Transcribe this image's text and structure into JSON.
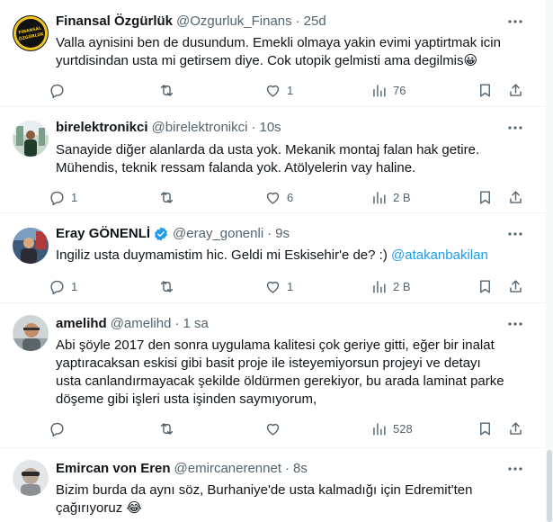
{
  "tweets": [
    {
      "name": "Finansal Özgürlük",
      "handle": "@Ozgurluk_Finans",
      "time": "25d",
      "verified": false,
      "avatar_text": "FİNANSAL ÖZGÜRLÜK",
      "lines": [
        "Valla aynisini ben de dusundum. Emekli olmaya yakin evimi yaptirtmak icin",
        "yurtdisindan usta mi getirsem diye. Cok utopik gelmisti ama degilmis😀"
      ],
      "replies": "",
      "retweets": "",
      "likes": "1",
      "views": "76"
    },
    {
      "name": "birelektronikci",
      "handle": "@birelektronikci",
      "time": "10s",
      "verified": false,
      "lines": [
        "Sanayide diğer alanlarda da usta yok. Mekanik montaj falan hak getire.",
        "Mühendis, teknik ressam falanda yok. Atölyelerin vay haline."
      ],
      "replies": "1",
      "retweets": "",
      "likes": "6",
      "views": "2 B"
    },
    {
      "name": "Eray GÖNENLİ",
      "handle": "@eray_gonenli",
      "time": "9s",
      "verified": true,
      "lines": [
        "Ingiliz usta duymamistim hic. Geldi mi Eskisehir'e de? :) "
      ],
      "mention": "@atakanbakilan",
      "replies": "1",
      "retweets": "",
      "likes": "1",
      "views": "2 B"
    },
    {
      "name": "amelihd",
      "handle": "@amelihd",
      "time": "1 sa",
      "verified": false,
      "lines": [
        "Abi şöyle 2017 den sonra uygulama kalitesi çok geriye gitti, eğer bir inalat",
        "yaptıracaksan eskisi gibi basit proje ile isteyemiyorsun projeyi ve detayı",
        "usta canlandırmayacak şekilde öldürmen gerekiyor, bu arada laminat parke",
        "döşeme gibi işleri usta işinden saymıyorum,"
      ],
      "replies": "",
      "retweets": "",
      "likes": "",
      "views": "528"
    },
    {
      "name": "Emircan von Eren",
      "handle": "@emircanerennet",
      "time": "8s",
      "verified": false,
      "lines": [
        "Bizim burda da aynı söz, Burhaniye'de usta kalmadığı için Edremit'ten",
        "çağırıyoruz 😂"
      ]
    }
  ],
  "sep": "·",
  "colors": {
    "text": "#0f1419",
    "secondary": "#536471",
    "accent": "#1d9bf0",
    "divider": "#eff3f4"
  },
  "icons": [
    "more-icon",
    "reply-icon",
    "retweet-icon",
    "like-icon",
    "views-icon",
    "bookmark-icon",
    "share-icon",
    "verified-icon"
  ]
}
